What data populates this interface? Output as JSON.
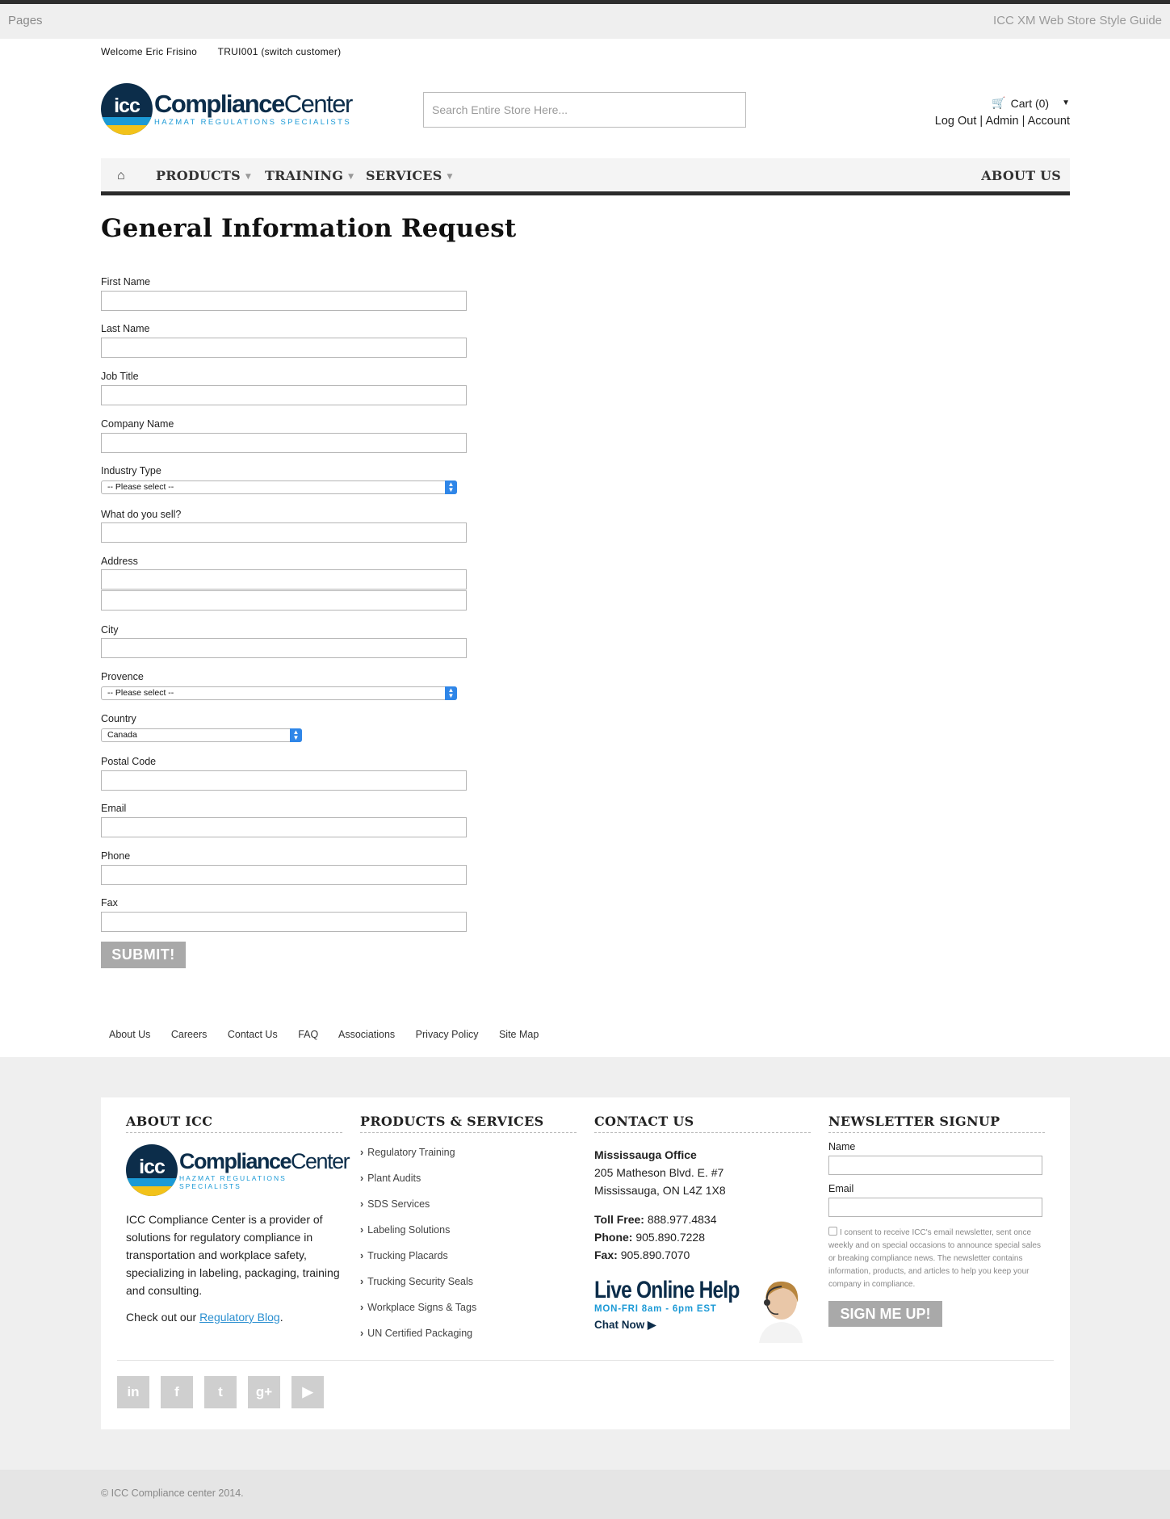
{
  "topbar": {
    "left": "Pages",
    "right": "ICC XM Web Store Style Guide"
  },
  "header": {
    "welcome": "Welcome Eric Frisino",
    "customer": "TRUI001 (switch customer)",
    "logo": {
      "circle_text": "icc",
      "brand_bold": "Compliance",
      "brand_light": "Center",
      "tagline": "HAZMAT REGULATIONS SPECIALISTS"
    },
    "search_placeholder": "Search Entire Store Here...",
    "cart_label": "Cart (0)",
    "links": {
      "logout": "Log Out",
      "admin": "Admin",
      "account": "Account",
      "sep": "|"
    }
  },
  "nav": {
    "home_icon": "home-icon",
    "products": "PRODUCTS",
    "training": "TRAINING",
    "services": "SERVICES",
    "about": "ABOUT US"
  },
  "page": {
    "title": "General Information Request"
  },
  "form": {
    "first_name": "First Name",
    "last_name": "Last Name",
    "job_title": "Job Title",
    "company_name": "Company Name",
    "industry_type": "Industry Type",
    "industry_value": "-- Please select --",
    "what_sell": "What do you sell?",
    "address": "Address",
    "city": "City",
    "province": "Provence",
    "province_value": "-- Please select --",
    "country": "Country",
    "country_value": "Canada",
    "postal": "Postal Code",
    "email": "Email",
    "phone": "Phone",
    "fax": "Fax",
    "submit": "SUBMIT!"
  },
  "footer_links": [
    "About Us",
    "Careers",
    "Contact Us",
    "FAQ",
    "Associations",
    "Privacy Policy",
    "Site Map"
  ],
  "footer": {
    "about": {
      "heading": "ABOUT ICC",
      "text": "ICC Compliance Center is a provider of solutions for regulatory compliance in transportation and workplace safety, specializing in labeling, packaging, training and consulting.",
      "blog_prefix": "Check out our ",
      "blog_link": "Regulatory Blog",
      "blog_suffix": "."
    },
    "products": {
      "heading": "PRODUCTS & SERVICES",
      "items": [
        "Regulatory Training",
        "Plant Audits",
        "SDS Services",
        "Labeling Solutions",
        "Trucking Placards",
        "Trucking Security Seals",
        "Workplace Signs & Tags",
        "UN Certified Packaging"
      ]
    },
    "contact": {
      "heading": "CONTACT US",
      "office": "Mississauga Office",
      "street": "205 Matheson Blvd. E. #7",
      "city": "Mississauga, ON L4Z 1X8",
      "toll_label": "Toll Free:",
      "toll": "888.977.4834",
      "phone_label": "Phone:",
      "phone": "905.890.7228",
      "fax_label": "Fax:",
      "fax": "905.890.7070",
      "live_title": "Live Online Help",
      "live_hours": "MON-FRI 8am - 6pm EST",
      "live_chat": "Chat Now ▶"
    },
    "newsletter": {
      "heading": "NEWSLETTER SIGNUP",
      "name_label": "Name",
      "email_label": "Email",
      "consent": "I consent to receive ICC's email newsletter, sent once weekly and on special occasions to announce special sales or breaking compliance news. The newsletter contains information, products, and articles to help you keep your company in compliance.",
      "button": "SIGN ME UP!"
    },
    "social": [
      {
        "name": "linkedin-icon",
        "glyph": "in"
      },
      {
        "name": "facebook-icon",
        "glyph": "f"
      },
      {
        "name": "twitter-icon",
        "glyph": "t"
      },
      {
        "name": "googleplus-icon",
        "glyph": "g+"
      },
      {
        "name": "youtube-icon",
        "glyph": "▶"
      }
    ]
  },
  "copyright": "© ICC Compliance center 2014."
}
